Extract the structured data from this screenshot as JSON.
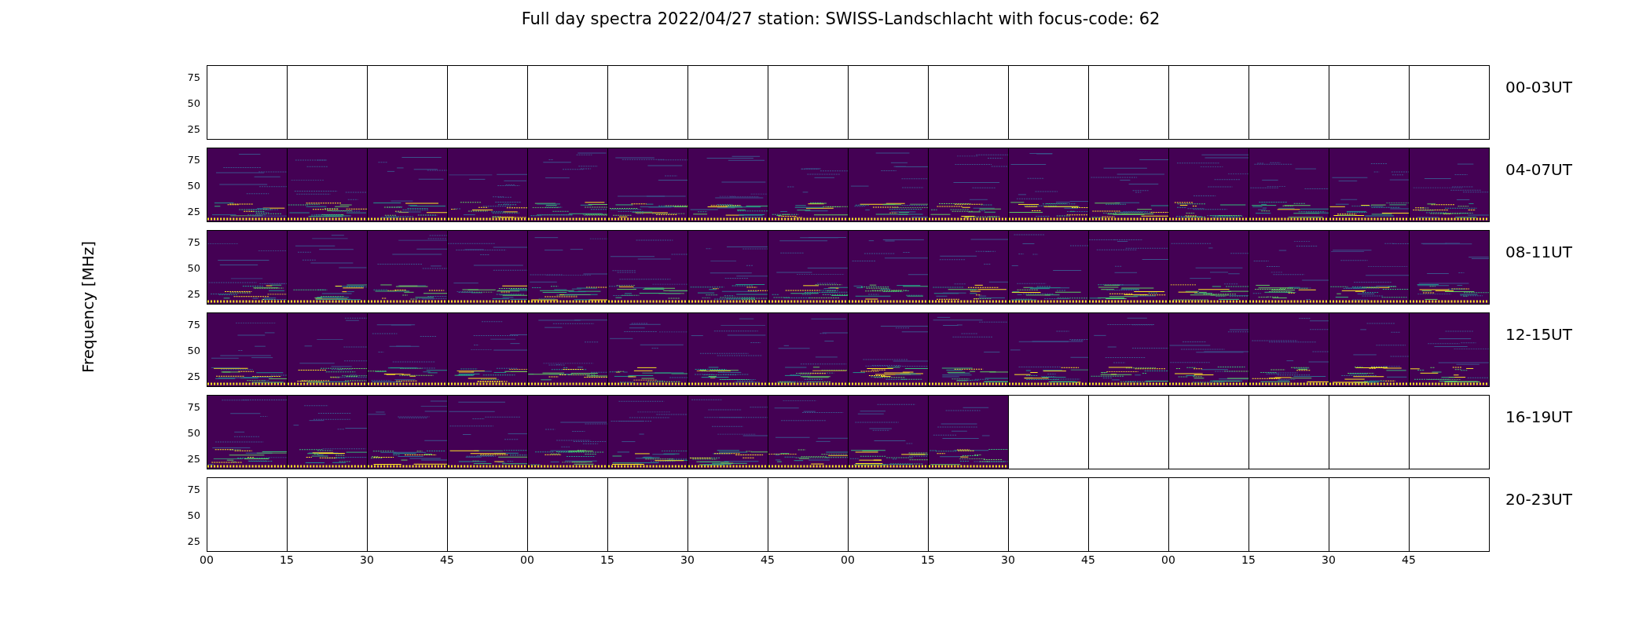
{
  "title": "Full day spectra 2022/04/27 station: SWISS-Landschlacht with focus-code: 62",
  "ylabel": "Frequency [MHz]",
  "rows": [
    {
      "label": "00-03UT",
      "yticks": [
        "75",
        "50",
        "25"
      ],
      "panels": [
        {
          "data": false
        },
        {
          "data": false
        },
        {
          "data": false
        },
        {
          "data": false
        },
        {
          "data": false
        },
        {
          "data": false
        },
        {
          "data": false
        },
        {
          "data": false
        },
        {
          "data": false
        },
        {
          "data": false
        },
        {
          "data": false
        },
        {
          "data": false
        },
        {
          "data": false
        },
        {
          "data": false
        },
        {
          "data": false
        },
        {
          "data": false
        }
      ]
    },
    {
      "label": "04-07UT",
      "yticks": [
        "75",
        "50",
        "25"
      ],
      "panels": [
        {
          "data": true
        },
        {
          "data": true
        },
        {
          "data": true
        },
        {
          "data": true
        },
        {
          "data": true
        },
        {
          "data": true
        },
        {
          "data": true
        },
        {
          "data": true
        },
        {
          "data": true
        },
        {
          "data": true
        },
        {
          "data": true
        },
        {
          "data": true
        },
        {
          "data": true
        },
        {
          "data": true
        },
        {
          "data": true
        },
        {
          "data": true
        }
      ]
    },
    {
      "label": "08-11UT",
      "yticks": [
        "75",
        "50",
        "25"
      ],
      "panels": [
        {
          "data": true
        },
        {
          "data": true
        },
        {
          "data": true
        },
        {
          "data": true
        },
        {
          "data": true
        },
        {
          "data": true
        },
        {
          "data": true
        },
        {
          "data": true
        },
        {
          "data": true
        },
        {
          "data": true
        },
        {
          "data": true
        },
        {
          "data": true
        },
        {
          "data": true
        },
        {
          "data": true
        },
        {
          "data": true
        },
        {
          "data": true
        }
      ]
    },
    {
      "label": "12-15UT",
      "yticks": [
        "75",
        "50",
        "25"
      ],
      "panels": [
        {
          "data": true
        },
        {
          "data": true
        },
        {
          "data": true
        },
        {
          "data": true
        },
        {
          "data": true
        },
        {
          "data": true
        },
        {
          "data": true
        },
        {
          "data": true
        },
        {
          "data": true
        },
        {
          "data": true
        },
        {
          "data": true
        },
        {
          "data": true
        },
        {
          "data": true
        },
        {
          "data": true
        },
        {
          "data": true
        },
        {
          "data": true
        }
      ]
    },
    {
      "label": "16-19UT",
      "yticks": [
        "75",
        "50",
        "25"
      ],
      "panels": [
        {
          "data": true
        },
        {
          "data": true
        },
        {
          "data": true
        },
        {
          "data": true
        },
        {
          "data": true
        },
        {
          "data": true
        },
        {
          "data": true
        },
        {
          "data": true
        },
        {
          "data": true
        },
        {
          "data": true
        },
        {
          "data": false
        },
        {
          "data": false
        },
        {
          "data": false
        },
        {
          "data": false
        },
        {
          "data": false
        },
        {
          "data": false
        }
      ]
    },
    {
      "label": "20-23UT",
      "yticks": [
        "75",
        "50",
        "25"
      ],
      "panels": [
        {
          "data": false
        },
        {
          "data": false
        },
        {
          "data": false
        },
        {
          "data": false
        },
        {
          "data": false
        },
        {
          "data": false
        },
        {
          "data": false
        },
        {
          "data": false
        },
        {
          "data": false
        },
        {
          "data": false
        },
        {
          "data": false
        },
        {
          "data": false
        },
        {
          "data": false
        },
        {
          "data": false
        },
        {
          "data": false
        },
        {
          "data": false
        }
      ]
    }
  ],
  "xticks": [
    "00",
    "15",
    "30",
    "45",
    "00",
    "15",
    "30",
    "45",
    "00",
    "15",
    "30",
    "45",
    "00",
    "15",
    "30",
    "45"
  ]
}
